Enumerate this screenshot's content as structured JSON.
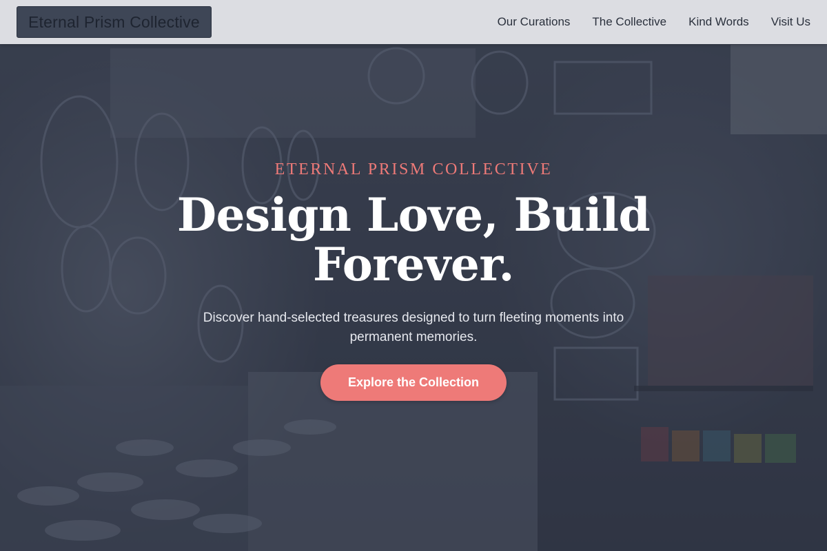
{
  "brand": {
    "name": "Eternal Prism Collective"
  },
  "nav": {
    "items": [
      {
        "label": "Our Curations"
      },
      {
        "label": "The Collective"
      },
      {
        "label": "Kind Words"
      },
      {
        "label": "Visit Us"
      }
    ]
  },
  "hero": {
    "eyebrow": "ETERNAL PRISM COLLECTIVE",
    "headline": "Design Love, Build Forever.",
    "subtitle": "Discover hand-selected treasures designed to turn fleeting moments into permanent memories.",
    "cta_label": "Explore the Collection"
  },
  "colors": {
    "accent": "#ee7a78",
    "header_bg": "#e8eaee",
    "logo_bg": "#3e4656",
    "overlay": "#262c3a"
  }
}
